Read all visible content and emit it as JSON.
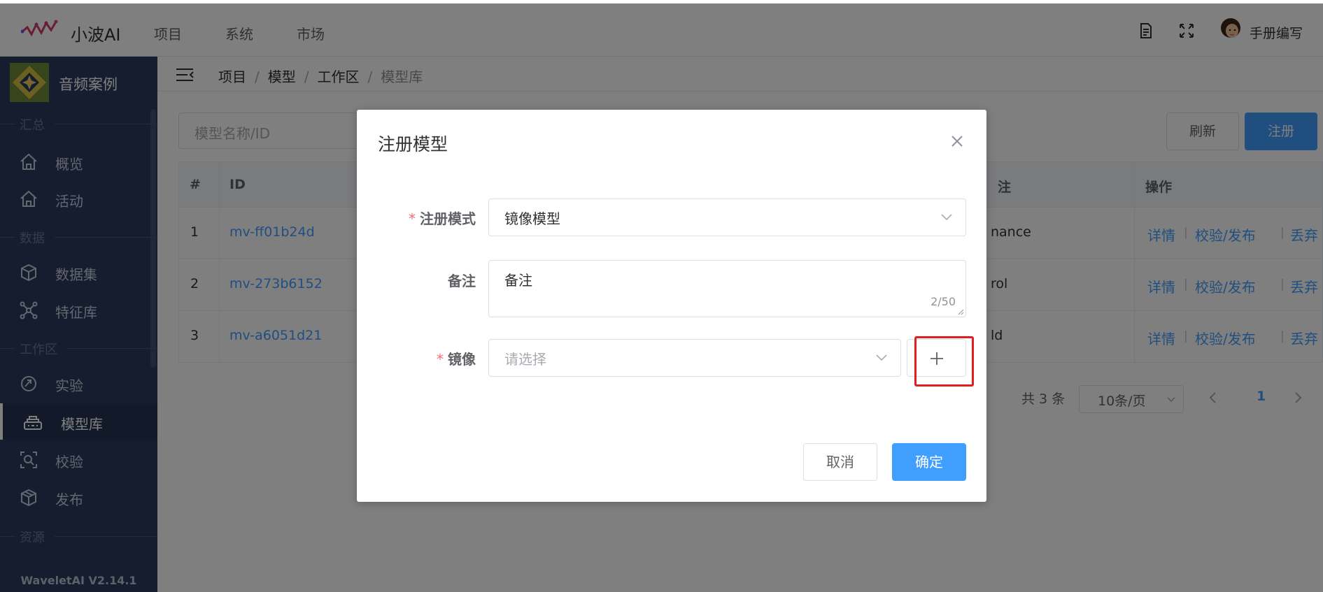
{
  "header": {
    "app_name": "小波AI",
    "nav": [
      "项目",
      "系统",
      "市场"
    ],
    "user_name": "手册编写",
    "icons": [
      "document-icon",
      "fullscreen-icon"
    ]
  },
  "sidebar": {
    "project_name": "音频案例",
    "groups": [
      "汇总",
      "数据",
      "工作区",
      "资源"
    ],
    "items": [
      "概览",
      "活动",
      "数据集",
      "特征库",
      "实验",
      "模型库",
      "校验",
      "发布"
    ],
    "active_item": "模型库",
    "version": "WaveletAI V2.14.1"
  },
  "breadcrumb": [
    "项目",
    "模型",
    "工作区",
    "模型库"
  ],
  "toolbar": {
    "search_placeholder": "模型名称/ID",
    "refresh_label": "刷新",
    "register_label": "注册"
  },
  "table": {
    "headers": {
      "index": "#",
      "id": "ID",
      "note": "注",
      "ops": "操作"
    },
    "rows": [
      {
        "index": "1",
        "id": "mv-ff01b24d",
        "note": "nance"
      },
      {
        "index": "2",
        "id": "mv-273b6152",
        "note": "rol"
      },
      {
        "index": "3",
        "id": "mv-a6051d21",
        "note": "ld"
      }
    ],
    "ops": [
      "详情",
      "校验/发布",
      "丢弃"
    ],
    "op_separator": "|"
  },
  "pagination": {
    "total": "共 3 条",
    "page_size": "10条/页",
    "current": "1"
  },
  "dialog": {
    "title": "注册模型",
    "fields": {
      "mode_label": "注册模式",
      "mode_value": "镜像模型",
      "note_label": "备注",
      "note_value": "备注",
      "note_count": "2/50",
      "image_label": "镜像",
      "image_placeholder": "请选择",
      "required_mark": "*"
    },
    "cancel_label": "取消",
    "ok_label": "确定"
  },
  "colors": {
    "primary": "#409eff",
    "sidebar_bg": "#2b3a5c",
    "highlight": "#e02020",
    "required": "#f56c6c"
  }
}
